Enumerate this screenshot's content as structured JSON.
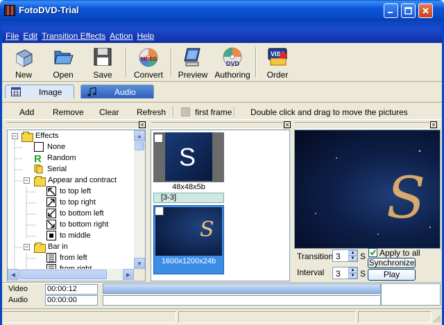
{
  "window": {
    "title": "FotoDVD-Trial"
  },
  "menu": [
    "File",
    "Edit",
    "Transition Effects",
    "Action",
    "Help"
  ],
  "toolbar": {
    "new": "New",
    "open": "Open",
    "save": "Save",
    "convert": "Convert",
    "preview": "Preview",
    "authoring": "Authoring",
    "order": "Order"
  },
  "tabs": {
    "image": "Image",
    "audio": "Audio"
  },
  "actions": {
    "add": "Add",
    "remove": "Remove",
    "clear": "Clear",
    "refresh": "Refresh",
    "first_frame": "first frame",
    "hint": "Double click and drag to move the pictures"
  },
  "tree": {
    "root": "Effects",
    "items": [
      "None",
      "Random",
      "Serial",
      "Appear and contract",
      "to top left",
      "to top right",
      "to bottom left",
      "to bottom right",
      "to middle",
      "Bar in",
      "from left",
      "from right"
    ]
  },
  "thumbs": [
    {
      "size": "48x48x5b",
      "caption": "[3-3]"
    },
    {
      "size": "1600x1200x24b"
    }
  ],
  "controls": {
    "transition_label": "Transition",
    "transition_value": "3",
    "transition_unit": "S",
    "interval_label": "Interval",
    "interval_value": "3",
    "interval_unit": "S",
    "apply_all": "Apply to all",
    "synchronize": "Synchronize",
    "play": "Play"
  },
  "timeline": {
    "video_label": "Video",
    "video_time": "00:00:12",
    "audio_label": "Audio",
    "audio_time": "00:00:00"
  },
  "colors": {
    "title_blue": "#0a56d8",
    "menu_blue": "#1c48c8",
    "selection": "#3a8ee6"
  }
}
